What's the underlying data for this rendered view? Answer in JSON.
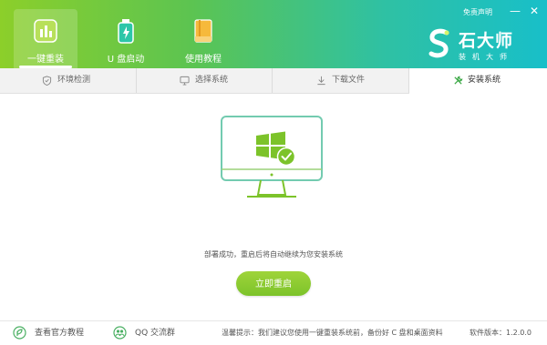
{
  "header": {
    "tabs": [
      {
        "label": "一键重装",
        "icon": "bar-chart-icon",
        "active": true
      },
      {
        "label": "U 盘启动",
        "icon": "usb-drive-icon",
        "active": false
      },
      {
        "label": "使用教程",
        "icon": "book-icon",
        "active": false
      }
    ],
    "disclaimer": "免责声明",
    "window_controls": {
      "minimize": "—",
      "close": "✕"
    },
    "logo": {
      "name": "石大师",
      "subtitle": "装机大师"
    }
  },
  "steps": [
    {
      "label": "环境检测",
      "icon": "shield-check-icon",
      "active": false
    },
    {
      "label": "选择系统",
      "icon": "monitor-icon",
      "active": false
    },
    {
      "label": "下载文件",
      "icon": "download-icon",
      "active": false
    },
    {
      "label": "安装系统",
      "icon": "wrench-icon",
      "active": true
    }
  ],
  "main": {
    "message": "部署成功，重启后将自动继续为您安装系统",
    "restart_button": "立即重启"
  },
  "footer": {
    "tutorial_link": "查看官方教程",
    "qq_group": "QQ 交流群",
    "notice": "温馨提示：我们建议您使用一键重装系统前，备份好 C 盘和桌面资料",
    "version": "软件版本：1.2.0.0"
  },
  "colors": {
    "accent_green": "#7cc32a",
    "header_gradient_start": "#8ccf2a",
    "header_gradient_end": "#18bfc9",
    "monitor_stroke": "#73cbb0"
  }
}
